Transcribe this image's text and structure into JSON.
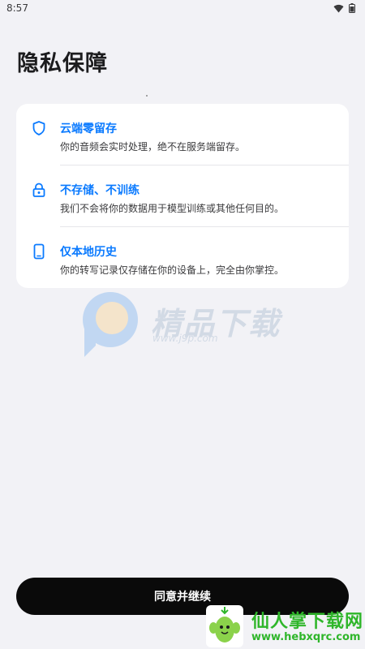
{
  "status_bar": {
    "time": "8:57",
    "icons": [
      "wifi-icon",
      "battery-icon"
    ]
  },
  "page": {
    "title": "隐私保障"
  },
  "features": [
    {
      "icon": "shield-icon",
      "title": "云端零留存",
      "description": "你的音频会实时处理，绝不在服务端留存。"
    },
    {
      "icon": "lock-icon",
      "title": "不存储、不训练",
      "description": "我们不会将你的数据用于模型训练或其他任何目的。"
    },
    {
      "icon": "phone-icon",
      "title": "仅本地历史",
      "description": "你的转写记录仅存储在你的设备上，完全由你掌控。"
    }
  ],
  "watermark": {
    "text": "精品下载",
    "url": "www.j9p.com"
  },
  "actions": {
    "continue_label": "同意并继续"
  },
  "corner_badge": {
    "name": "仙人掌下载网",
    "url": "www.hebxqrc.com"
  },
  "colors": {
    "accent": "#0a7aff",
    "background": "#f2f2f6",
    "button": "#0a0a0a"
  }
}
